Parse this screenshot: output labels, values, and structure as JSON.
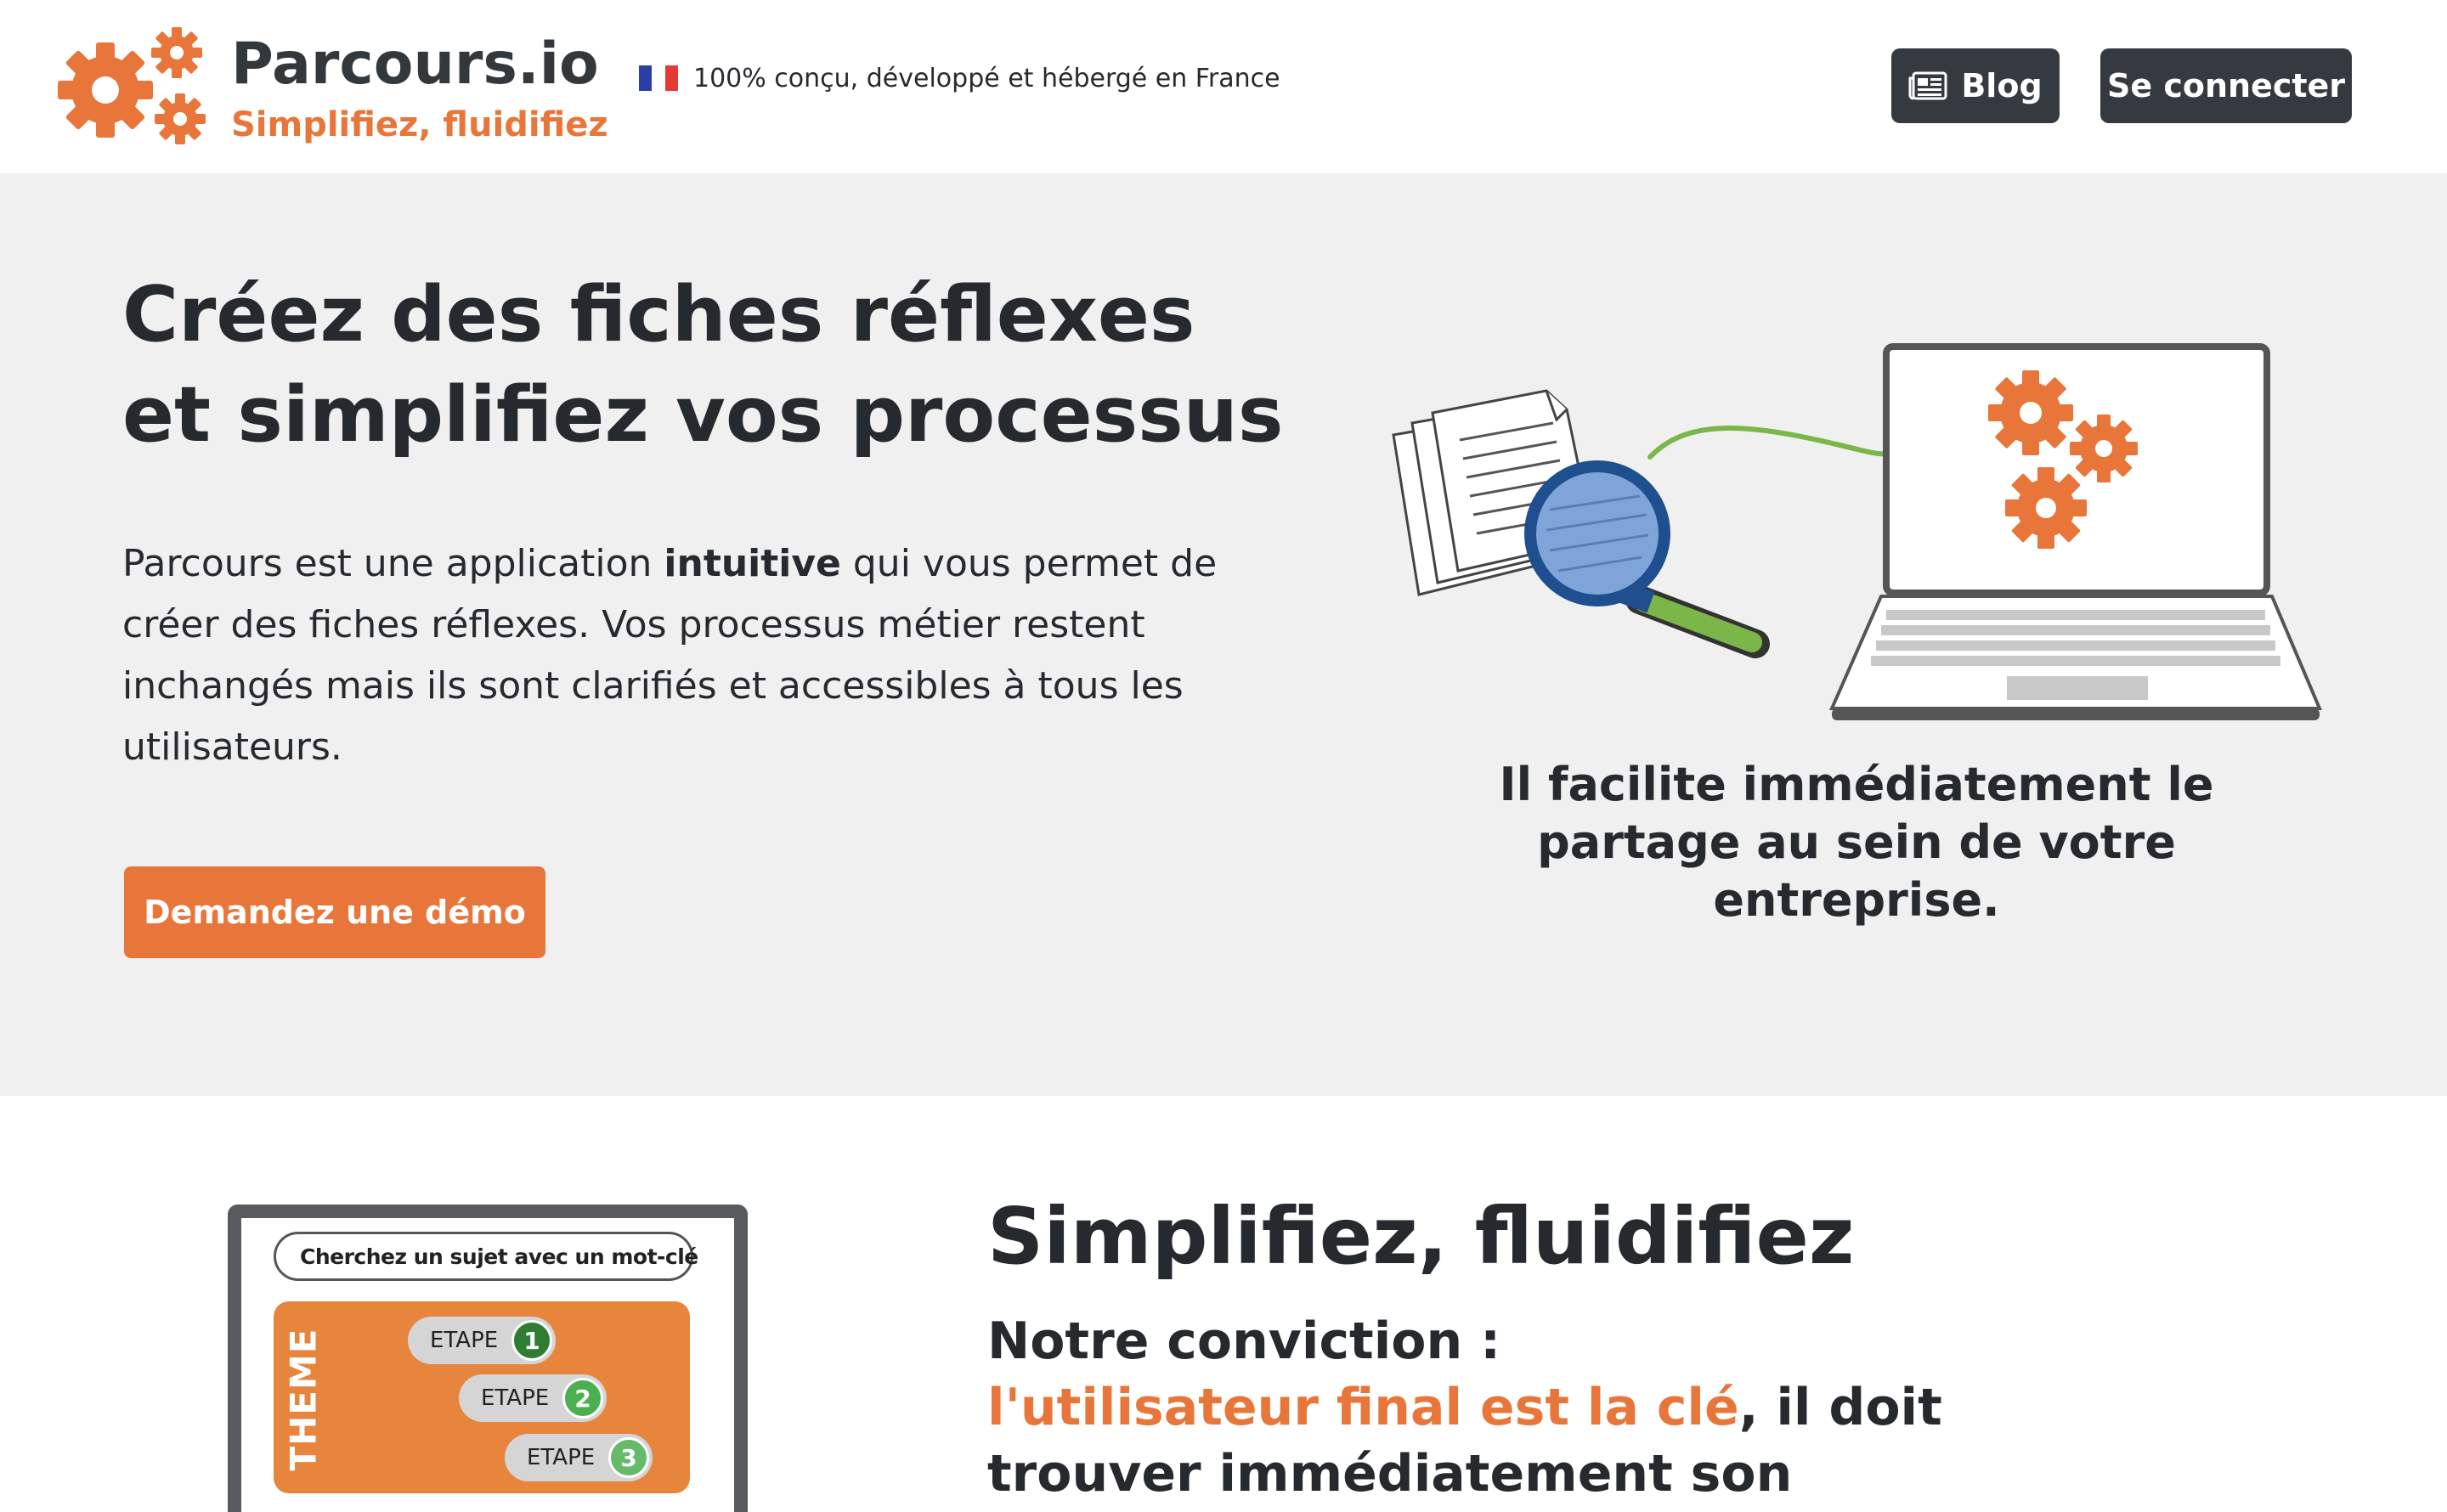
{
  "colors": {
    "brand_orange": "#e8763a",
    "dark_button": "#343a40",
    "hero_bg": "#f0f0f0",
    "green": "#7ab648"
  },
  "header": {
    "logo_title": "Parcours.io",
    "logo_tagline": "Simplifiez, fluidifiez",
    "made_in_france": "100% conçu, développé et hébergé en France",
    "blog_label": "Blog",
    "login_label": "Se connecter"
  },
  "hero": {
    "title": "Créez des fiches réflexes et simplifiez vos processus",
    "desc_part1": "Parcours est une application ",
    "desc_bold": "intuitive",
    "desc_part2": " qui vous permet de créer des fiches réflexes. Vos processus métier restent inchangés mais ils sont clarifiés et accessibles à tous les utilisateurs.",
    "demo_label": "Demandez une démo",
    "caption": "Il facilite immédiatement le partage au sein de votre entreprise."
  },
  "section2": {
    "title": "Simplifiez, fluidifiez",
    "sub_line1": "Notre conviction :",
    "sub_accent": "l'utilisateur final est la clé",
    "sub_rest": ", il doit trouver immédiatement son processus",
    "mock": {
      "search_placeholder": "Cherchez un sujet avec un mot-clé",
      "theme_label": "THEME",
      "steps": [
        {
          "label": "ETAPE",
          "number": "1",
          "color": "#2e7d32"
        },
        {
          "label": "ETAPE",
          "number": "2",
          "color": "#4caf50"
        },
        {
          "label": "ETAPE",
          "number": "3",
          "color": "#66bb6a"
        }
      ]
    }
  }
}
